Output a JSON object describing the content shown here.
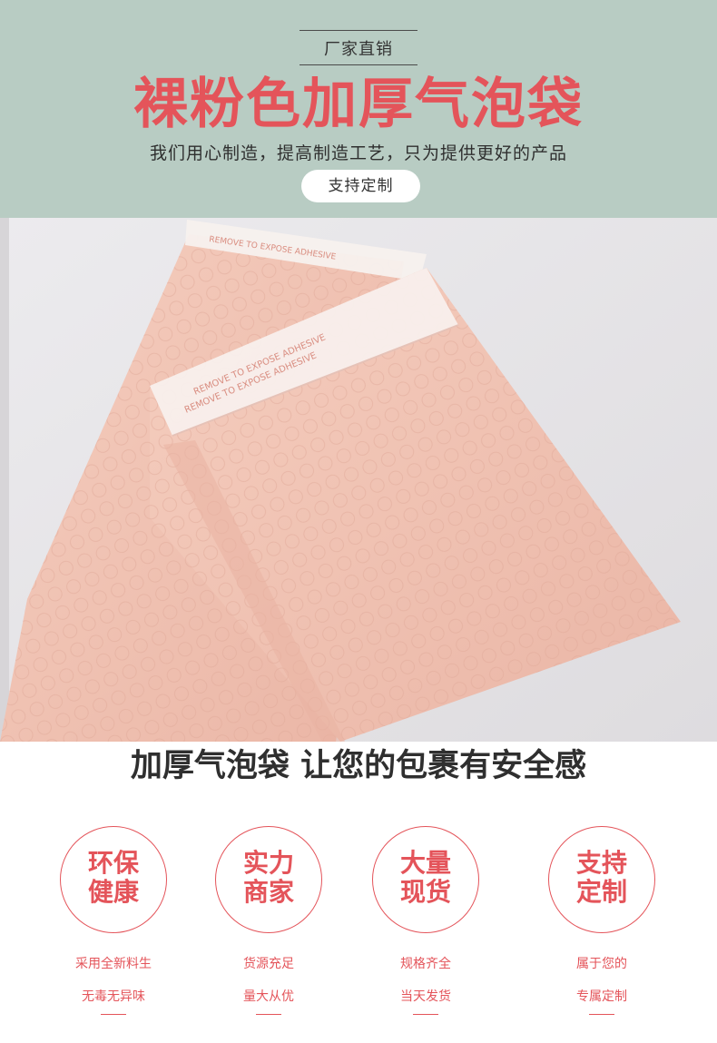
{
  "header": {
    "tagline": "厂家直销",
    "title": "裸粉色加厚气泡袋",
    "subtitle": "我们用心制造，提高制造工艺，只为提供更好的产品",
    "custom_button": "支持定制"
  },
  "photo": {
    "strip_text": "REMOVE TO EXPOSE ADHESIVE"
  },
  "slogan": "加厚气泡袋 让您的包裹有安全感",
  "features": [
    {
      "title_line1": "环保",
      "title_line2": "健康",
      "desc1": "采用全新料生",
      "desc2": "无毒无异味"
    },
    {
      "title_line1": "实力",
      "title_line2": "商家",
      "desc1": "货源充足",
      "desc2": "量大从优"
    },
    {
      "title_line1": "大量",
      "title_line2": "现货",
      "desc1": "规格齐全",
      "desc2": "当天发货"
    },
    {
      "title_line1": "支持",
      "title_line2": "定制",
      "desc1": "属于您的",
      "desc2": "专属定制"
    }
  ],
  "colors": {
    "banner_bg": "#b8ccc3",
    "accent_red": "#e4545a",
    "bag_pink": "#f2c3b4",
    "photo_bg": "#e9e7ea"
  }
}
